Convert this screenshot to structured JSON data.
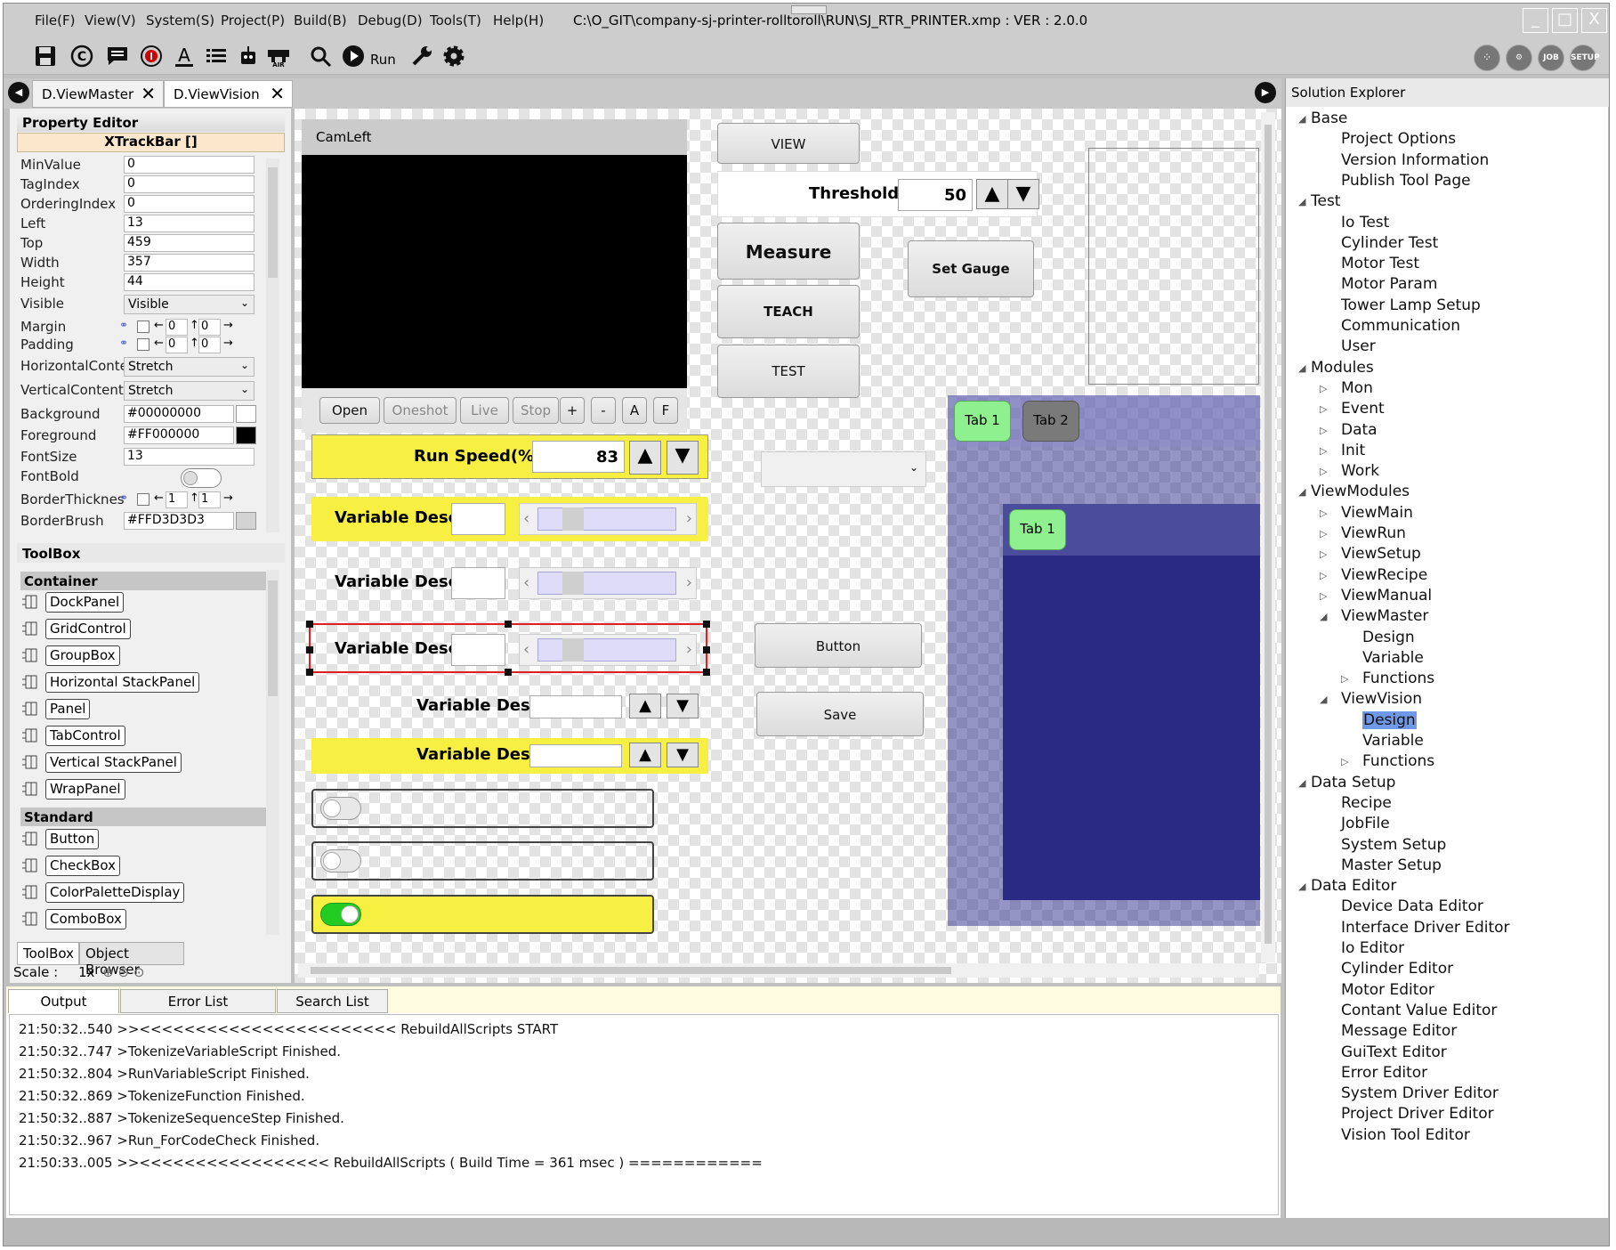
{
  "menu": [
    "File(F)",
    "View(V)",
    "System(S)",
    "Project(P)",
    "Build(B)",
    "Debug(D)",
    "Tools(T)",
    "Help(H)"
  ],
  "title_path": "C:\\O_GIT\\company-sj-printer-rolltoroll\\RUN\\SJ_RTR_PRINTER.xmp :  VER : 2.0.0",
  "window_buttons": {
    "min": "_",
    "max": "□",
    "close": "X"
  },
  "toolbar": {
    "run_label": "Run",
    "right_icons": [
      "apps-icon",
      "settings-icon",
      "JOB",
      "SETUP"
    ]
  },
  "doc_tabs": [
    {
      "label": "D.ViewMaster"
    },
    {
      "label": "D.ViewVision"
    }
  ],
  "property_editor": {
    "title": "Property Editor",
    "control": "XTrackBar []",
    "rows": [
      {
        "label": "MinValue",
        "value": "0"
      },
      {
        "label": "TagIndex",
        "value": "0"
      },
      {
        "label": "OrderingIndex",
        "value": "0"
      },
      {
        "label": "Left",
        "value": "13"
      },
      {
        "label": "Top",
        "value": "459"
      },
      {
        "label": "Width",
        "value": "357"
      },
      {
        "label": "Height",
        "value": "44"
      }
    ],
    "visible": {
      "label": "Visible",
      "value": "Visible"
    },
    "margin": {
      "label": "Margin",
      "l": "0",
      "t": "0"
    },
    "padding": {
      "label": "Padding",
      "l": "0",
      "t": "0"
    },
    "hcontent": {
      "label": "HorizontalConter",
      "value": "Stretch"
    },
    "vcontent": {
      "label": "VerticalContentAl",
      "value": "Stretch"
    },
    "background": {
      "label": "Background",
      "value": "#00000000",
      "swatch": "#ffffff"
    },
    "foreground": {
      "label": "Foreground",
      "value": "#FF000000",
      "swatch": "#000000"
    },
    "fontsize": {
      "label": "FontSize",
      "value": "13"
    },
    "fontbold": {
      "label": "FontBold"
    },
    "borderthickness": {
      "label": "BorderThickness",
      "l": "1",
      "t": "1"
    },
    "borderbrush": {
      "label": "BorderBrush",
      "value": "#FFD3D3D3",
      "swatch": "#d3d3d3"
    }
  },
  "toolbox": {
    "title": "ToolBox",
    "container_label": "Container",
    "container_items": [
      "DockPanel",
      "GridControl",
      "GroupBox",
      "Horizontal StackPanel",
      "Panel",
      "TabControl",
      "Vertical StackPanel",
      "WrapPanel"
    ],
    "standard_label": "Standard",
    "standard_items": [
      "Button",
      "CheckBox",
      "ColorPaletteDisplay",
      "ComboBox"
    ],
    "tabs": [
      "ToolBox",
      "Object Browser"
    ],
    "scale_label": "Scale :",
    "scale_value": "1x"
  },
  "canvas": {
    "cam_title": "CamLeft",
    "cam_buttons": [
      "Open",
      "Oneshot",
      "Live",
      "Stop",
      "+",
      "-",
      "A",
      "F"
    ],
    "run_speed": {
      "label": "Run Speed(%) :",
      "value": "83"
    },
    "var_desc": "Variable Desc :",
    "view_btn": "VIEW",
    "threshold": {
      "label": "Threshold :",
      "value": "50"
    },
    "measure_btn": "Measure",
    "set_gauge_btn": "Set Gauge",
    "teach_btn": "TEACH",
    "test_btn": "TEST",
    "button_btn": "Button",
    "save_btn": "Save",
    "tab1": "Tab 1",
    "tab2": "Tab 2",
    "inner_tab": "Tab 1",
    "toggle_on_color": "#22cc22",
    "yellow": "#f7ef41",
    "tab_bg": "#2a2a85"
  },
  "solution_explorer": {
    "title": "Solution Explorer",
    "nodes": [
      {
        "t": "Base",
        "lvl": 0,
        "exp": "open"
      },
      {
        "t": "Project Options",
        "lvl": 1
      },
      {
        "t": "Version Information",
        "lvl": 1
      },
      {
        "t": "Publish Tool Page",
        "lvl": 1
      },
      {
        "t": "Test",
        "lvl": 0,
        "exp": "open"
      },
      {
        "t": "Io Test",
        "lvl": 1
      },
      {
        "t": "Cylinder Test",
        "lvl": 1
      },
      {
        "t": "Motor Test",
        "lvl": 1
      },
      {
        "t": "Motor Param",
        "lvl": 1
      },
      {
        "t": "Tower Lamp Setup",
        "lvl": 1
      },
      {
        "t": "Communication",
        "lvl": 1
      },
      {
        "t": "User",
        "lvl": 1
      },
      {
        "t": "Modules",
        "lvl": 0,
        "exp": "open"
      },
      {
        "t": "Mon",
        "lvl": 1,
        "exp": "closed"
      },
      {
        "t": "Event",
        "lvl": 1,
        "exp": "closed"
      },
      {
        "t": "Data",
        "lvl": 1,
        "exp": "closed"
      },
      {
        "t": "Init",
        "lvl": 1,
        "exp": "closed"
      },
      {
        "t": "Work",
        "lvl": 1,
        "exp": "closed"
      },
      {
        "t": "ViewModules",
        "lvl": 0,
        "exp": "open"
      },
      {
        "t": "ViewMain",
        "lvl": 1,
        "exp": "closed"
      },
      {
        "t": "ViewRun",
        "lvl": 1,
        "exp": "closed"
      },
      {
        "t": "ViewSetup",
        "lvl": 1,
        "exp": "closed"
      },
      {
        "t": "ViewRecipe",
        "lvl": 1,
        "exp": "closed"
      },
      {
        "t": "ViewManual",
        "lvl": 1,
        "exp": "closed"
      },
      {
        "t": "ViewMaster",
        "lvl": 1,
        "exp": "open"
      },
      {
        "t": "Design",
        "lvl": 2
      },
      {
        "t": "Variable",
        "lvl": 2
      },
      {
        "t": "Functions",
        "lvl": 2,
        "exp": "closed"
      },
      {
        "t": "ViewVision",
        "lvl": 1,
        "exp": "open"
      },
      {
        "t": "Design",
        "lvl": 2,
        "sel": true
      },
      {
        "t": "Variable",
        "lvl": 2
      },
      {
        "t": "Functions",
        "lvl": 2,
        "exp": "closed"
      },
      {
        "t": "Data Setup",
        "lvl": 0,
        "exp": "open"
      },
      {
        "t": "Recipe",
        "lvl": 1
      },
      {
        "t": "JobFile",
        "lvl": 1
      },
      {
        "t": "System Setup",
        "lvl": 1
      },
      {
        "t": "Master Setup",
        "lvl": 1
      },
      {
        "t": "Data Editor",
        "lvl": 0,
        "exp": "open"
      },
      {
        "t": "Device Data Editor",
        "lvl": 1
      },
      {
        "t": "Interface Driver Editor",
        "lvl": 1
      },
      {
        "t": "Io Editor",
        "lvl": 1
      },
      {
        "t": "Cylinder Editor",
        "lvl": 1
      },
      {
        "t": "Motor Editor",
        "lvl": 1
      },
      {
        "t": "Contant Value Editor",
        "lvl": 1
      },
      {
        "t": "Message Editor",
        "lvl": 1
      },
      {
        "t": "GuiText Editor",
        "lvl": 1
      },
      {
        "t": "Error Editor",
        "lvl": 1
      },
      {
        "t": "System Driver Editor",
        "lvl": 1
      },
      {
        "t": "Project Driver Editor",
        "lvl": 1
      },
      {
        "t": "Vision Tool Editor",
        "lvl": 1
      }
    ]
  },
  "output": {
    "tabs": [
      "Output",
      "Error List",
      "Search List"
    ],
    "lines": [
      "21:50:32..540 >><<<<<<<<<<<<<<<<<<<<<<< RebuildAllScripts START",
      "21:50:32..747 >TokenizeVariableScript Finished.",
      "21:50:32..804 >RunVariableScript Finished.",
      "21:50:32..869 >TokenizeFunction Finished.",
      "21:50:32..887 >TokenizeSequenceStep Finished.",
      "21:50:32..967 >Run_ForCodeCheck Finished.",
      "21:50:33..005 >><<<<<<<<<<<<<<<<< RebuildAllScripts ( Build Time = 361 msec ) ============"
    ]
  }
}
